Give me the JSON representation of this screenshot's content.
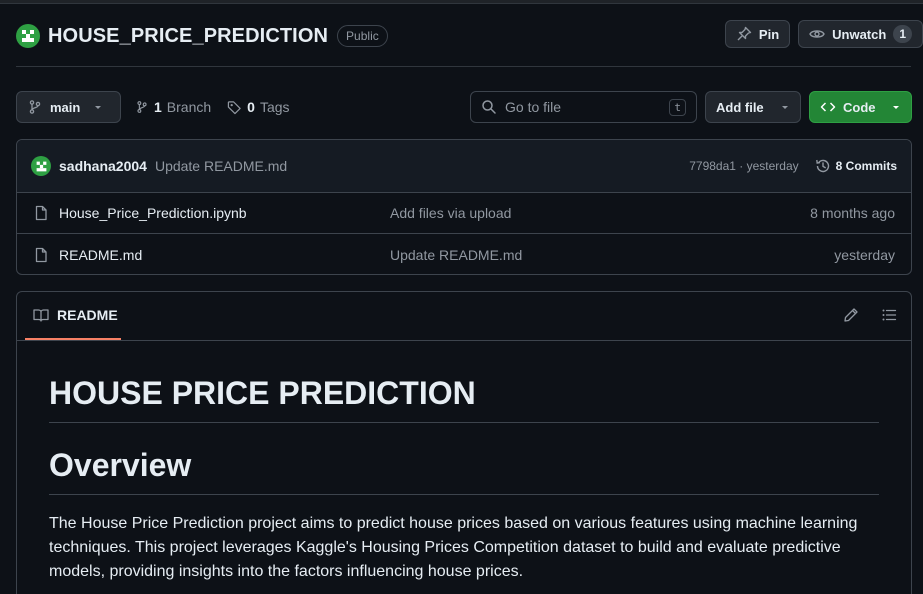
{
  "repo": {
    "name": "HOUSE_PRICE_PREDICTION",
    "visibility": "Public",
    "pin_label": "Pin",
    "unwatch_label": "Unwatch",
    "watch_count": "1"
  },
  "toolbar": {
    "branch": "main",
    "branch_count": "1",
    "branch_label": "Branch",
    "tag_count": "0",
    "tag_label": "Tags",
    "search_placeholder": "Go to file",
    "search_shortcut": "t",
    "add_file_label": "Add file",
    "code_label": "Code"
  },
  "latest_commit": {
    "author": "sadhana2004",
    "message": "Update README.md",
    "hash_time": "7798da1 · yesterday",
    "commits_label": "8 Commits"
  },
  "files": [
    {
      "name": "House_Price_Prediction.ipynb",
      "message": "Add files via upload",
      "date": "8 months ago"
    },
    {
      "name": "README.md",
      "message": "Update README.md",
      "date": "yesterday"
    }
  ],
  "readme": {
    "tab_label": "README",
    "h1": "HOUSE PRICE PREDICTION",
    "h2": "Overview",
    "paragraph": "The House Price Prediction project aims to predict house prices based on various features using machine learning techniques. This project leverages Kaggle's Housing Prices Competition dataset to build and evaluate predictive models, providing insights into the factors influencing house prices."
  },
  "colors": {
    "background": "#0d1117",
    "accent_green": "#238636",
    "tab_underline": "#f78166"
  },
  "icons": [
    "avatar-identicon",
    "pin-icon",
    "eye-icon",
    "branch-icon",
    "tag-icon",
    "search-icon",
    "caret-down-icon",
    "code-icon",
    "history-icon",
    "file-icon",
    "book-icon",
    "pencil-icon",
    "list-icon"
  ]
}
